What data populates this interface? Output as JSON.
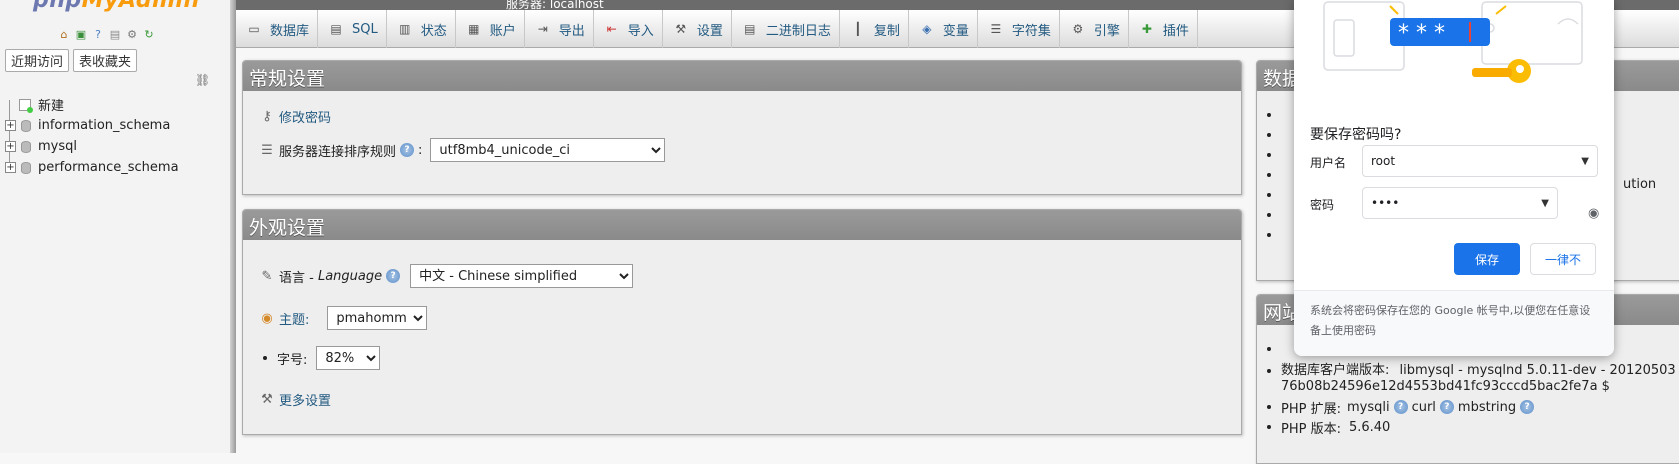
{
  "nav": {
    "logo_prefix": "php",
    "logo_suffix": "MyAdmin",
    "recent_label": "近期访问",
    "favorites_label": "表收藏夹",
    "new_label": "新建",
    "databases": [
      "information_schema",
      "mysql",
      "performance_schema"
    ]
  },
  "topbar": {
    "breadcrumb": "服务器: localhost"
  },
  "tabs": [
    {
      "label": "数据库",
      "icon": "database-icon"
    },
    {
      "label": "SQL",
      "icon": "sql-icon"
    },
    {
      "label": "状态",
      "icon": "status-icon"
    },
    {
      "label": "账户",
      "icon": "accounts-icon"
    },
    {
      "label": "导出",
      "icon": "export-icon"
    },
    {
      "label": "导入",
      "icon": "import-icon"
    },
    {
      "label": "设置",
      "icon": "wrench-icon"
    },
    {
      "label": "二进制日志",
      "icon": "binlog-icon"
    },
    {
      "label": "复制",
      "icon": "replication-icon"
    },
    {
      "label": "变量",
      "icon": "variables-icon"
    },
    {
      "label": "字符集",
      "icon": "charset-icon"
    },
    {
      "label": "引擎",
      "icon": "engine-icon"
    },
    {
      "label": "插件",
      "icon": "plugin-icon"
    }
  ],
  "general": {
    "title": "常规设置",
    "change_password": "修改密码",
    "collation_label": "服务器连接排序规则",
    "collation_value": "utf8mb4_unicode_ci"
  },
  "appearance": {
    "title": "外观设置",
    "language_label": "语言 - ",
    "language_en": "Language",
    "language_value": "中文 - Chinese simplified",
    "theme_label": "主题:",
    "theme_value": "pmahomme",
    "fontsize_label": "字号:",
    "fontsize_value": "82%",
    "more_settings": "更多设置"
  },
  "db_server": {
    "title_fragment": "数据",
    "partial_text": "ution"
  },
  "web_server": {
    "title_fragment": "网站",
    "client_label": "数据库客户端版本:",
    "client_value": "libmysql - mysqlnd 5.0.11-dev - 20120503",
    "client_value_2": "76b08b24596e12d4553bd41fc93cccd5bac2fe7a $",
    "php_ext_label": "PHP 扩展:",
    "php_ext": [
      "mysqli",
      "curl",
      "mbstring"
    ],
    "php_version_label": "PHP 版本:",
    "php_version": "5.6.40"
  },
  "password_popup": {
    "illus_mask": "* * *",
    "title": "要保存密码吗?",
    "username_label": "用户名",
    "username_value": "root",
    "password_label": "密码",
    "password_value": "••••",
    "save_label": "保存",
    "never_label": "一律不",
    "footer": "系统会将密码保存在您的 Google 帐号中,以便您在任意设备上使用密码"
  }
}
